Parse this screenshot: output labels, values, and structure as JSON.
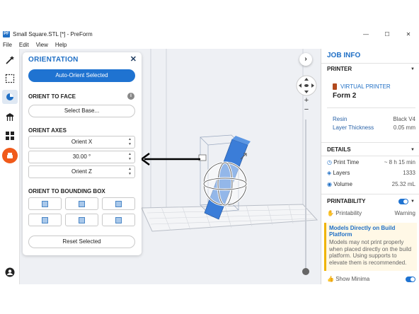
{
  "window": {
    "title": "Small Square.STL [*] - PreForm",
    "controls": [
      "—",
      "☐",
      "✕"
    ]
  },
  "menu": [
    "File",
    "Edit",
    "View",
    "Help"
  ],
  "left_rail": {
    "tools": [
      "magic-wand-icon",
      "select-box-icon",
      "orientation-icon",
      "supports-icon",
      "layout-icon",
      "print-icon"
    ],
    "active": "orientation-icon"
  },
  "orientation_panel": {
    "title": "ORIENTATION",
    "close": "✕",
    "auto_orient_label": "Auto-Orient Selected",
    "orient_to_face_label": "ORIENT TO FACE",
    "info": "i",
    "select_base_label": "Select Base...",
    "orient_axes_label": "ORIENT AXES",
    "axis_x": "Orient X",
    "axis_y_value": "30.00 °",
    "axis_z": "Orient Z",
    "bounding_box_label": "ORIENT TO BOUNDING BOX",
    "reset_label": "Reset Selected"
  },
  "job_info": {
    "title": "JOB INFO",
    "printer_section": "PRINTER",
    "printer_type": "VIRTUAL PRINTER",
    "printer_name": "Form 2",
    "resin_label": "Resin",
    "resin_value": "Black V4",
    "layer_label": "Layer Thickness",
    "layer_value": "0.05 mm",
    "details_section": "DETAILS",
    "print_time_label": "Print Time",
    "print_time_value": "~ 8 h 15 min",
    "layers_label": "Layers",
    "layers_value": "1333",
    "volume_label": "Volume",
    "volume_value": "25.32 mL",
    "printability_section": "PRINTABILITY",
    "printability_label": "Printability",
    "printability_value": "Warning",
    "warning_title": "Models Directly on Build Platform",
    "warning_text": "Models may not print properly when placed directly on the build platform. Using supports to elevate them is recommended.",
    "show_minima_label": "Show Minima"
  },
  "viewport": {
    "nav_arrow": "›",
    "zoom_in": "+",
    "zoom_out": "−"
  },
  "colors": {
    "accent": "#1f73d1",
    "orange": "#f05a1a",
    "warning": "#f0b400",
    "model": "#3b7dd8"
  }
}
